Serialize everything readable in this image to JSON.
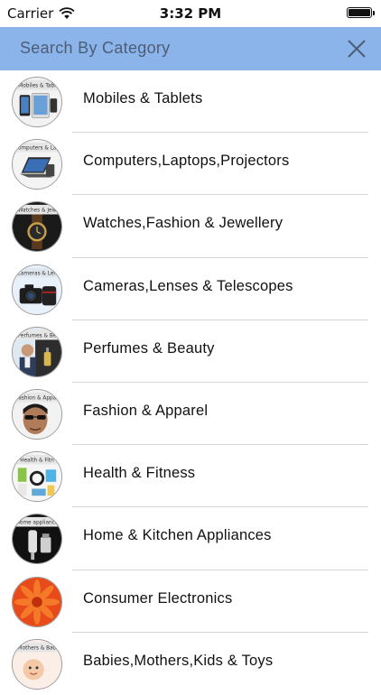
{
  "status": {
    "carrier": "Carrier",
    "time": "3:32 PM"
  },
  "header": {
    "title": "Search By Category",
    "close_icon": "close-icon"
  },
  "categories": [
    {
      "label": "Mobiles & Tablets",
      "thumb_caption": "Mobiles & Tabl",
      "icon": "mobiles-tablets-thumbnail"
    },
    {
      "label": "Computers,Laptops,Projectors",
      "thumb_caption": "Computers & Lap",
      "icon": "computers-thumbnail"
    },
    {
      "label": "Watches,Fashion & Jewellery",
      "thumb_caption": "Watches & Jew",
      "icon": "watches-thumbnail"
    },
    {
      "label": "Cameras,Lenses & Telescopes",
      "thumb_caption": "Cameras & Len",
      "icon": "cameras-thumbnail"
    },
    {
      "label": "Perfumes & Beauty",
      "thumb_caption": "Perfumes & Be",
      "icon": "perfumes-thumbnail"
    },
    {
      "label": "Fashion & Apparel",
      "thumb_caption": "Fashion & Appar",
      "icon": "fashion-thumbnail"
    },
    {
      "label": "Health & Fitness",
      "thumb_caption": "Health & Fitn",
      "icon": "health-thumbnail"
    },
    {
      "label": "Home & Kitchen Appliances",
      "thumb_caption": "Home appliance",
      "icon": "home-kitchen-thumbnail"
    },
    {
      "label": "Consumer Electronics",
      "thumb_caption": "",
      "icon": "consumer-electronics-thumbnail"
    },
    {
      "label": "Babies,Mothers,Kids & Toys",
      "thumb_caption": "Mothers & Bab",
      "icon": "babies-thumbnail"
    }
  ],
  "colors": {
    "header_bg": "#8ab4ea",
    "header_text": "#4d5d76",
    "divider": "#d6d6d6"
  }
}
